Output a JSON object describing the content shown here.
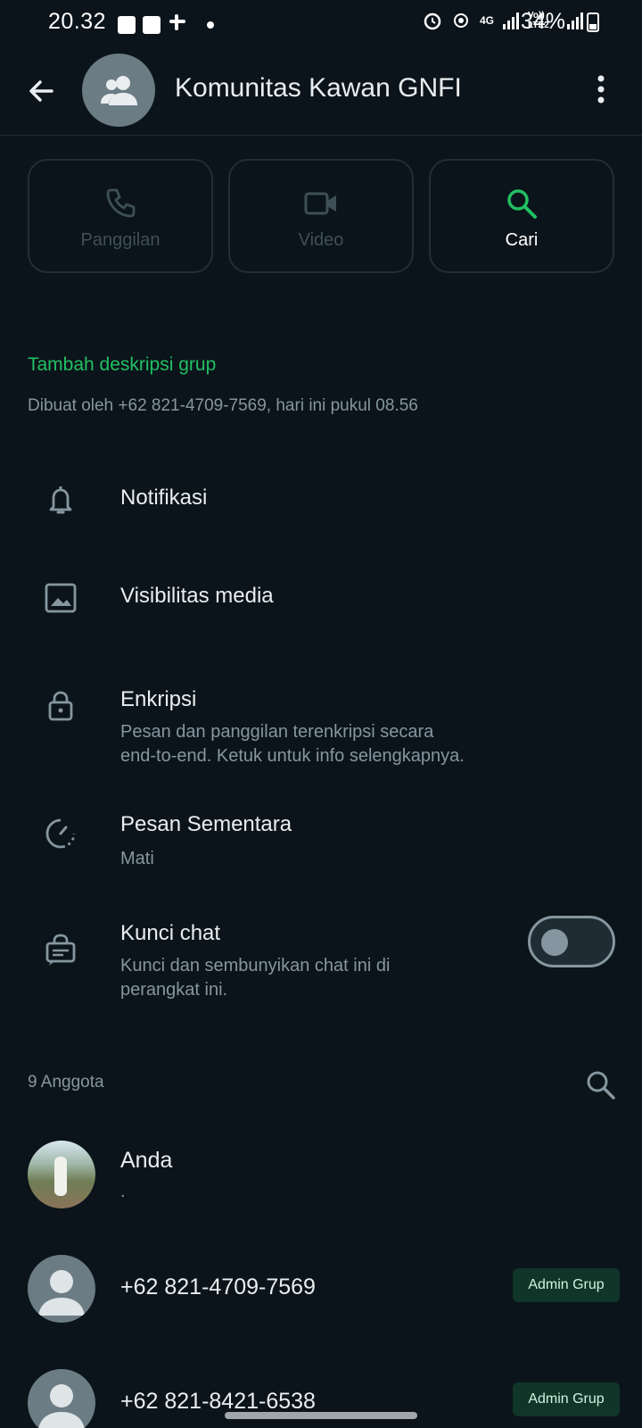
{
  "status_bar": {
    "time": "20.32",
    "battery": "34%",
    "network_labels": [
      "4G",
      "Vo)) LTE2"
    ],
    "icons": [
      "gallery-icon",
      "ai-icon",
      "slack-icon",
      "dot-icon",
      "alarm-icon",
      "hotspot-icon",
      "signal-icon",
      "signal-icon",
      "battery-icon"
    ]
  },
  "header": {
    "title": "Komunitas Kawan GNFI",
    "back_icon": "arrow-left-icon",
    "menu_icon": "more-vert-icon"
  },
  "actions": [
    {
      "label": "Panggilan",
      "icon": "phone-icon",
      "state": "disabled"
    },
    {
      "label": "Video",
      "icon": "video-icon",
      "state": "disabled"
    },
    {
      "label": "Cari",
      "icon": "search-icon",
      "state": "active"
    }
  ],
  "description": {
    "add_label": "Tambah deskripsi grup",
    "created_text": "Dibuat oleh +62 821-4709-7569, hari ini pukul 08.56"
  },
  "settings": [
    {
      "title": "Notifikasi",
      "subtitle": "",
      "icon": "bell-icon"
    },
    {
      "title": "Visibilitas media",
      "subtitle": "",
      "icon": "image-icon"
    },
    {
      "title": "Enkripsi",
      "subtitle_line1": "Pesan dan panggilan terenkripsi secara",
      "subtitle_line2": "end-to-end. Ketuk untuk info selengkapnya.",
      "icon": "lock-icon"
    },
    {
      "title": "Pesan Sementara",
      "subtitle": "Mati",
      "icon": "timer-icon"
    },
    {
      "title": "Kunci chat",
      "subtitle_line1": "Kunci dan sembunyikan chat ini di",
      "subtitle_line2": "perangkat ini.",
      "icon": "chat-lock-icon",
      "toggle_on": false
    }
  ],
  "members": {
    "count_label": "9 Anggota",
    "list": [
      {
        "name": "Anda",
        "subtitle": ".",
        "badge": ""
      },
      {
        "name": "+62 821-4709-7569",
        "subtitle": "",
        "badge": "Admin Grup"
      },
      {
        "name": "+62 821-8421-6538",
        "subtitle": "",
        "badge": "Admin Grup"
      }
    ]
  },
  "colors": {
    "background": "#0b141a",
    "accent_green": "#21c063",
    "secondary_text": "#8696a0",
    "badge_bg": "#103529"
  }
}
